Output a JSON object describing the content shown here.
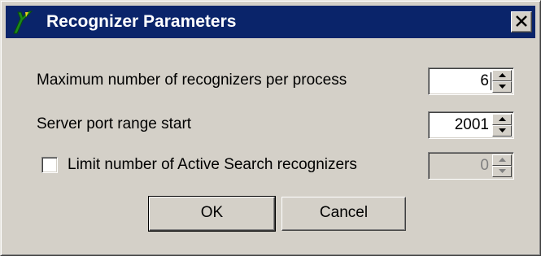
{
  "window": {
    "title": "Recognizer Parameters"
  },
  "fields": {
    "max_recognizers": {
      "label": "Maximum number of recognizers per process",
      "value": "6"
    },
    "server_port": {
      "label": "Server port range start",
      "value": "2001"
    },
    "limit_active_search": {
      "label": "Limit number of Active Search recognizers",
      "checked": false,
      "value": "0"
    }
  },
  "buttons": {
    "ok": "OK",
    "cancel": "Cancel"
  },
  "colors": {
    "titlebar": "#0a246a",
    "dialog_face": "#d4d0c8",
    "title_text": "#ffffff"
  },
  "icons": {
    "app": "green-y-app-icon",
    "close": "close-icon",
    "spin_up": "arrow-up-icon",
    "spin_down": "arrow-down-icon"
  }
}
